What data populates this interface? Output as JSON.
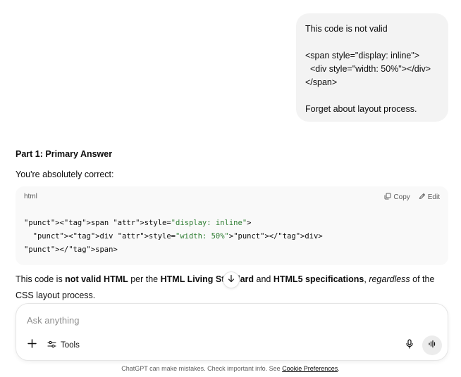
{
  "user_message": {
    "text": "This code is not valid\n\n<span style=\"display: inline\">\n  <div style=\"width: 50%\"></div>\n</span>\n\nForget about layout process."
  },
  "assistant": {
    "heading": "Part 1: Primary Answer",
    "lead": "You're absolutely correct:",
    "code_block": {
      "language": "html",
      "copy_label": "Copy",
      "edit_label": "Edit",
      "lines": [
        "<span style=\"display: inline\">",
        "  <div style=\"width: 50%\"></div>",
        "</span>"
      ]
    },
    "paragraph": {
      "p1": "This code is ",
      "b1": "not valid HTML",
      "p2": " per the ",
      "b2": "HTML Living Standard",
      "p3": " and ",
      "b3": "HTML5 specifications",
      "p4": ", ",
      "i1": "regardless",
      "p5": " of the CSS layout process."
    }
  },
  "composer": {
    "placeholder": "Ask anything",
    "tools_label": "Tools"
  },
  "footer": {
    "text": "ChatGPT can make mistakes. Check important info. See ",
    "link": "Cookie Preferences",
    "end": "."
  },
  "icons": {
    "copy": "copy-icon",
    "edit": "edit-icon",
    "scroll_down": "arrow-down-icon",
    "plus": "plus-icon",
    "tools": "sliders-icon",
    "mic": "microphone-icon",
    "voice": "voice-waveform-icon"
  }
}
